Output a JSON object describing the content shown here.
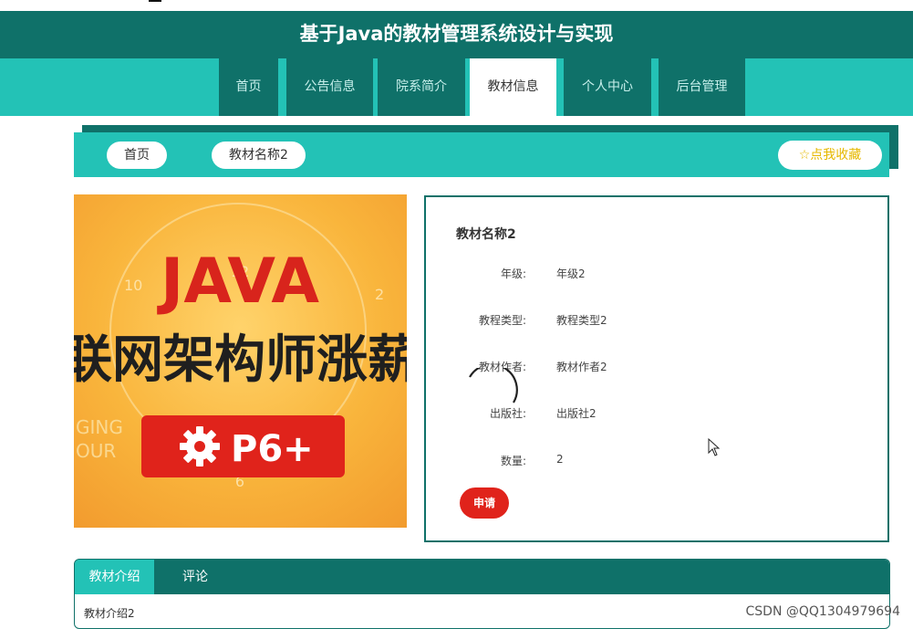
{
  "header": {
    "title": "基于Java的教材管理系统设计与实现"
  },
  "nav": {
    "items": [
      {
        "label": "首页",
        "active": false
      },
      {
        "label": "公告信息",
        "active": false
      },
      {
        "label": "院系简介",
        "active": false
      },
      {
        "label": "教材信息",
        "active": true
      },
      {
        "label": "个人中心",
        "active": false
      },
      {
        "label": "后台管理",
        "active": false
      }
    ]
  },
  "breadcrumb": {
    "home": "首页",
    "current": "教材名称2"
  },
  "favorite": {
    "label": "点我收藏",
    "icon": "star-outline-icon"
  },
  "cover": {
    "title_text": "JAVA",
    "subtitle_text": "联网架构师涨薪",
    "badge_text": "P6+",
    "side_text": "GING\nOUR"
  },
  "detail": {
    "title": "教材名称2",
    "rows": [
      {
        "label": "年级:",
        "value": "年级2"
      },
      {
        "label": "教程类型:",
        "value": "教程类型2"
      },
      {
        "label": "教材作者:",
        "value": "教材作者2"
      },
      {
        "label": "出版社:",
        "value": "出版社2"
      },
      {
        "label": "数量:",
        "value": "2"
      }
    ],
    "apply_label": "申请"
  },
  "tabs": {
    "items": [
      {
        "label": "教材介绍",
        "active": true
      },
      {
        "label": "评论",
        "active": false
      }
    ],
    "content": "教材介绍2"
  },
  "watermark": "CSDN @QQ1304979694",
  "colors": {
    "primary_dark": "#0f7169",
    "primary_light": "#23c2b6",
    "danger": "#e0231b",
    "star": "#e6b800"
  }
}
